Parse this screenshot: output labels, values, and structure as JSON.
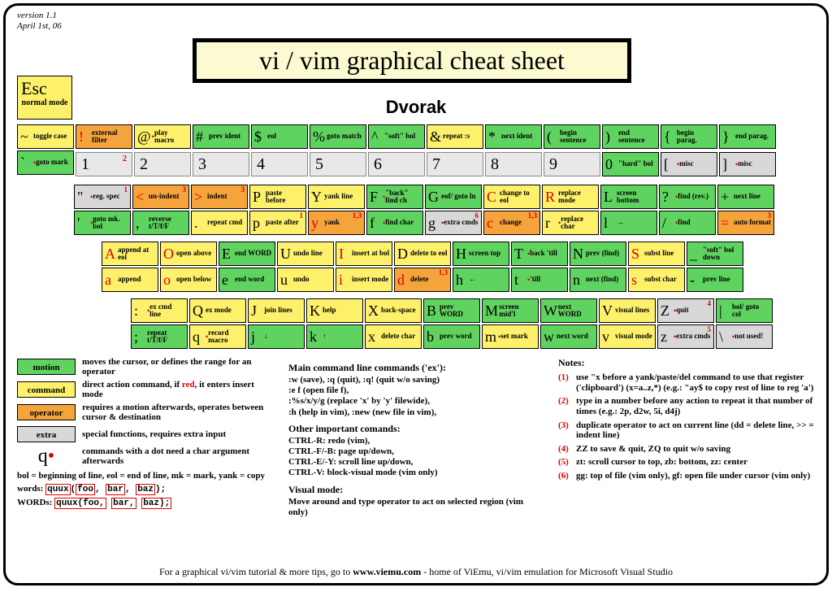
{
  "meta": {
    "version": "version 1.1",
    "date": "April 1st, 06"
  },
  "title": "vi / vim graphical cheat sheet",
  "subtitle": "Dvorak",
  "esc": {
    "key": "Esc",
    "label": "normal mode"
  },
  "row1": [
    {
      "sym": "~",
      "lbl": "toggle case",
      "cls": "command"
    },
    {
      "sym": "!",
      "lbl": "external filter",
      "cls": "operator",
      "red": true
    },
    {
      "sym": "@",
      "lbl": "play macro",
      "cls": "command",
      "dot": true
    },
    {
      "sym": "#",
      "lbl": "prev ident",
      "cls": "motion"
    },
    {
      "sym": "$",
      "lbl": "eol",
      "cls": "motion"
    },
    {
      "sym": "%",
      "lbl": "goto match",
      "cls": "motion"
    },
    {
      "sym": "^",
      "lbl": "\"soft\" bol",
      "cls": "motion"
    },
    {
      "sym": "&",
      "lbl": "repeat :s",
      "cls": "command"
    },
    {
      "sym": "*",
      "lbl": "next ident",
      "cls": "motion"
    },
    {
      "sym": "(",
      "lbl": "begin sentence",
      "cls": "motion"
    },
    {
      "sym": ")",
      "lbl": "end sentence",
      "cls": "motion"
    },
    {
      "sym": "{",
      "lbl": "begin parag.",
      "cls": "motion"
    },
    {
      "sym": "}",
      "lbl": "end parag.",
      "cls": "motion"
    }
  ],
  "row1b_first": {
    "sym": "`",
    "lbl": "goto mark",
    "cls": "motion",
    "dot": true
  },
  "numrow": [
    {
      "n": "1",
      "sup": "2"
    },
    {
      "n": "2"
    },
    {
      "n": "3"
    },
    {
      "n": "4"
    },
    {
      "n": "5"
    },
    {
      "n": "6"
    },
    {
      "n": "7"
    },
    {
      "n": "8"
    },
    {
      "n": "9"
    }
  ],
  "numrow_end": [
    {
      "sym": "0",
      "lbl": "\"hard\" bol",
      "cls": "motion"
    },
    {
      "sym": "[",
      "lbl": "misc",
      "cls": "extra",
      "dot": true
    },
    {
      "sym": "]",
      "lbl": "misc",
      "cls": "extra",
      "dot": true
    }
  ],
  "row2": [
    [
      {
        "sym": "\"",
        "lbl": "reg. spec",
        "cls": "extra",
        "dot": true,
        "sup": "1"
      },
      {
        "sym": "'",
        "lbl": "goto mk. bol",
        "cls": "motion",
        "dot": true
      }
    ],
    [
      {
        "sym": "<",
        "lbl": "un-indent",
        "cls": "operator",
        "red": true,
        "sup": "3"
      },
      {
        "sym": ",",
        "lbl": "reverse t/T/f/F",
        "cls": "motion"
      }
    ],
    [
      {
        "sym": ">",
        "lbl": "indent",
        "cls": "operator",
        "red": true,
        "sup": "3"
      },
      {
        "sym": ".",
        "lbl": "repeat cmd",
        "cls": "command"
      }
    ],
    [
      {
        "sym": "P",
        "lbl": "paste before",
        "cls": "command"
      },
      {
        "sym": "p",
        "lbl": "paste after",
        "cls": "command",
        "sup": "1"
      }
    ],
    [
      {
        "sym": "Y",
        "lbl": "yank line",
        "cls": "command"
      },
      {
        "sym": "y",
        "lbl": "yank",
        "cls": "operator",
        "red": true,
        "sup": "1,3"
      }
    ],
    [
      {
        "sym": "F",
        "lbl": "\"back\" find ch",
        "cls": "motion",
        "dot": true
      },
      {
        "sym": "f",
        "lbl": "find char",
        "cls": "motion",
        "dot": true
      }
    ],
    [
      {
        "sym": "G",
        "lbl": "eof/ goto ln",
        "cls": "motion"
      },
      {
        "sym": "g",
        "lbl": "extra cmds",
        "cls": "extra",
        "dot": true,
        "sup": "6"
      }
    ],
    [
      {
        "sym": "C",
        "lbl": "change to eol",
        "cls": "command",
        "red": true
      },
      {
        "sym": "c",
        "lbl": "change",
        "cls": "operator",
        "red": true,
        "sup": "1,3"
      }
    ],
    [
      {
        "sym": "R",
        "lbl": "replace mode",
        "cls": "command",
        "red": true
      },
      {
        "sym": "r",
        "lbl": "replace char",
        "cls": "command",
        "dot": true
      }
    ],
    [
      {
        "sym": "L",
        "lbl": "screen bottom",
        "cls": "motion"
      },
      {
        "sym": "l",
        "lbl": "→",
        "cls": "motion",
        "arrow": true
      }
    ],
    [
      {
        "sym": "?",
        "lbl": "find (rev.)",
        "cls": "motion",
        "dot": true
      },
      {
        "sym": "/",
        "lbl": "find",
        "cls": "motion",
        "dot": true
      }
    ],
    [
      {
        "sym": "+",
        "lbl": "next line",
        "cls": "motion"
      },
      {
        "sym": "=",
        "lbl": "auto format",
        "cls": "operator",
        "red": true,
        "sup": "3"
      }
    ]
  ],
  "row3": [
    [
      {
        "sym": "A",
        "lbl": "append at eol",
        "cls": "command",
        "red": true
      },
      {
        "sym": "a",
        "lbl": "append",
        "cls": "command",
        "red": true
      }
    ],
    [
      {
        "sym": "O",
        "lbl": "open above",
        "cls": "command",
        "red": true
      },
      {
        "sym": "o",
        "lbl": "open below",
        "cls": "command",
        "red": true
      }
    ],
    [
      {
        "sym": "E",
        "lbl": "end WORD",
        "cls": "motion"
      },
      {
        "sym": "e",
        "lbl": "end word",
        "cls": "motion"
      }
    ],
    [
      {
        "sym": "U",
        "lbl": "undo line",
        "cls": "command"
      },
      {
        "sym": "u",
        "lbl": "undo",
        "cls": "command"
      }
    ],
    [
      {
        "sym": "I",
        "lbl": "insert at bol",
        "cls": "command",
        "red": true
      },
      {
        "sym": "i",
        "lbl": "insert mode",
        "cls": "command",
        "red": true
      }
    ],
    [
      {
        "sym": "D",
        "lbl": "delete to eol",
        "cls": "command"
      },
      {
        "sym": "d",
        "lbl": "delete",
        "cls": "operator",
        "red": true,
        "sup": "1,3"
      }
    ],
    [
      {
        "sym": "H",
        "lbl": "screen top",
        "cls": "motion"
      },
      {
        "sym": "h",
        "lbl": "←",
        "cls": "motion",
        "arrow": true
      }
    ],
    [
      {
        "sym": "T",
        "lbl": "back 'till",
        "cls": "motion",
        "dot": true
      },
      {
        "sym": "t",
        "lbl": "'till",
        "cls": "motion",
        "dot": true
      }
    ],
    [
      {
        "sym": "N",
        "lbl": "prev (find)",
        "cls": "motion"
      },
      {
        "sym": "n",
        "lbl": "next (find)",
        "cls": "motion"
      }
    ],
    [
      {
        "sym": "S",
        "lbl": "subst line",
        "cls": "command",
        "red": true
      },
      {
        "sym": "s",
        "lbl": "subst char",
        "cls": "command",
        "red": true
      }
    ],
    [
      {
        "sym": "_",
        "lbl": "\"soft\" bol down",
        "cls": "motion"
      },
      {
        "sym": "-",
        "lbl": "prev line",
        "cls": "motion"
      }
    ]
  ],
  "row4": [
    [
      {
        "sym": ":",
        "lbl": "ex cmd line",
        "cls": "command",
        "dot": true
      },
      {
        "sym": ";",
        "lbl": "repeat t/T/f/F",
        "cls": "motion"
      }
    ],
    [
      {
        "sym": "Q",
        "lbl": "ex mode",
        "cls": "command"
      },
      {
        "sym": "q",
        "lbl": "record macro",
        "cls": "command",
        "dot": true
      }
    ],
    [
      {
        "sym": "J",
        "lbl": "join lines",
        "cls": "command"
      },
      {
        "sym": "j",
        "lbl": "↓",
        "cls": "motion",
        "arrow": true
      }
    ],
    [
      {
        "sym": "K",
        "lbl": "help",
        "cls": "command"
      },
      {
        "sym": "k",
        "lbl": "↑",
        "cls": "motion",
        "arrow": true
      }
    ],
    [
      {
        "sym": "X",
        "lbl": "back-space",
        "cls": "command"
      },
      {
        "sym": "x",
        "lbl": "delete char",
        "cls": "command"
      }
    ],
    [
      {
        "sym": "B",
        "lbl": "prev WORD",
        "cls": "motion"
      },
      {
        "sym": "b",
        "lbl": "prev word",
        "cls": "motion"
      }
    ],
    [
      {
        "sym": "M",
        "lbl": "screen mid'l",
        "cls": "motion"
      },
      {
        "sym": "m",
        "lbl": "set mark",
        "cls": "command",
        "dot": true
      }
    ],
    [
      {
        "sym": "W",
        "lbl": "next WORD",
        "cls": "motion"
      },
      {
        "sym": "w",
        "lbl": "next word",
        "cls": "motion"
      }
    ],
    [
      {
        "sym": "V",
        "lbl": "visual lines",
        "cls": "command"
      },
      {
        "sym": "v",
        "lbl": "visual mode",
        "cls": "command"
      }
    ],
    [
      {
        "sym": "Z",
        "lbl": "quit",
        "cls": "extra",
        "dot": true,
        "sup": "4"
      },
      {
        "sym": "z",
        "lbl": "extra cmds",
        "cls": "extra",
        "dot": true,
        "sup": "5"
      }
    ],
    [
      {
        "sym": "|",
        "lbl": "bol/ goto col",
        "cls": "motion"
      },
      {
        "sym": "\\",
        "lbl": "not used!",
        "cls": "extra",
        "dot": true
      }
    ]
  ],
  "legend": [
    {
      "box": "motion",
      "cls": "motion",
      "txt": "moves the cursor, or defines the range for an operator"
    },
    {
      "box": "command",
      "cls": "command",
      "txt": "direct action command, if |red|, it enters insert mode"
    },
    {
      "box": "operator",
      "cls": "operator",
      "txt": "requires a motion afterwards, operates between cursor & destination"
    },
    {
      "box": "extra",
      "cls": "extra",
      "txt": "special functions, requires extra input"
    }
  ],
  "q_dot_txt": "commands with a dot need a char argument afterwards",
  "abbrev": "bol = beginning of line, eol = end of line, mk = mark, yank = copy",
  "words_lbl": "words:",
  "WORDs_lbl": "WORDs:",
  "words_code": "quux(foo, bar, baz);",
  "mid": {
    "h1": "Main command line commands ('ex'):",
    "p1": ":w (save), :q (quit), :q! (quit w/o saving)\n:e f (open file f),\n:%s/x/y/g (replace 'x' by 'y' filewide),\n:h (help in vim), :new (new file in vim),",
    "h2": "Other important comands:",
    "p2": "CTRL-R: redo (vim),\nCTRL-F/-B: page up/down,\nCTRL-E/-Y: scroll line up/down,\nCTRL-V: block-visual mode (vim only)",
    "h3": "Visual mode:",
    "p3": "Move around and type operator to act on selected region (vim only)"
  },
  "notes_h": "Notes:",
  "notes": [
    {
      "n": "(1)",
      "t": "use \"x before a yank/paste/del command to use that register ('clipboard') (x=a..z,*) (e.g.: \"ay$ to copy rest of line to reg 'a')"
    },
    {
      "n": "(2)",
      "t": "type in a number before any action to repeat it that number of times (e.g.: 2p, d2w, 5i, d4j)"
    },
    {
      "n": "(3)",
      "t": "duplicate operator to act on current line (dd = delete line, >> = indent line)"
    },
    {
      "n": "(4)",
      "t": "ZZ to save & quit, ZQ to quit w/o saving"
    },
    {
      "n": "(5)",
      "t": "zt: scroll cursor to top, zb: bottom, zz: center"
    },
    {
      "n": "(6)",
      "t": "gg: top of file (vim only), gf: open file under cursor (vim only)"
    }
  ],
  "footer": "For a graphical vi/vim tutorial & more tips, go to  |www.viemu.com|  - home of ViEmu, vi/vim emulation for Microsoft Visual Studio"
}
